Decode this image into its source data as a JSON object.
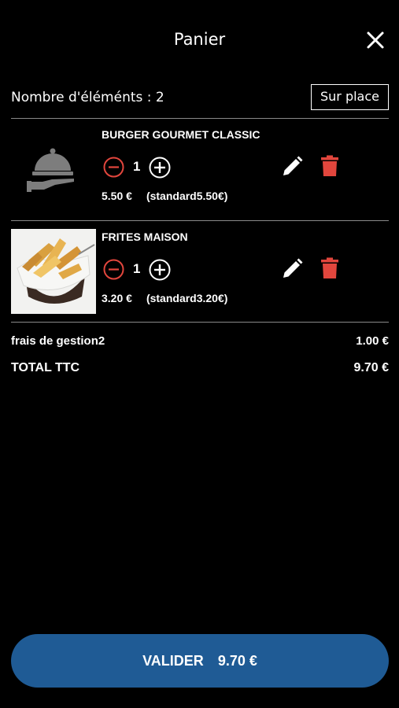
{
  "header": {
    "title": "Panier",
    "close_icon": "close-icon"
  },
  "cart": {
    "count_label": "Nombre d'éléménts : 2",
    "mode_button": "Sur place",
    "items": [
      {
        "name": "BURGER GOURMET CLASSIC",
        "quantity": "1",
        "price": "5.50 €",
        "standard_price": "(standard5.50€)",
        "image": "cloche-placeholder-icon"
      },
      {
        "name": "FRITES MAISON",
        "quantity": "1",
        "price": "3.20 €",
        "standard_price": "(standard3.20€)",
        "image": "fries-photo"
      }
    ]
  },
  "summary": {
    "fee_label": "frais de gestion2",
    "fee_value": "1.00 €",
    "total_label": "TOTAL TTC",
    "total_value": "9.70 €"
  },
  "footer": {
    "validate_label": "VALIDER",
    "validate_amount": "9.70 €"
  },
  "colors": {
    "background": "#000000",
    "minus": "#e2463d",
    "delete": "#e2463d",
    "primary_button": "#1f5b95",
    "divider": "#8a8a8a"
  }
}
